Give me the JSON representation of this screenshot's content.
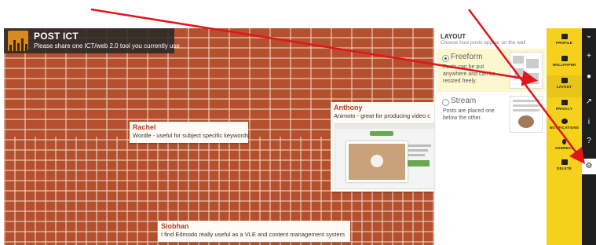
{
  "wall": {
    "title": "POST ICT",
    "subtitle": "Please share one ICT/web 2.0 tool you currently use"
  },
  "posts": [
    {
      "author": "Rachel",
      "body": "Wordle - useful for subject specific keywords"
    },
    {
      "author": "Anthony",
      "body": "Animoto - great for producing video c"
    },
    {
      "author": "Siobhan",
      "body": "I find Edmodo really useful as a VLE and content management system"
    }
  ],
  "layout_panel": {
    "title": "LAYOUT",
    "subtitle": "Choose how posts appear on the wall",
    "options": [
      {
        "name": "Freeform",
        "desc": "Posts can be put anywhere and can be resized freely.",
        "selected": true
      },
      {
        "name": "Stream",
        "desc": "Posts are placed one below the other.",
        "selected": false
      }
    ]
  },
  "sidebar": {
    "items": [
      {
        "label": "PROFILE",
        "icon": "profile-icon"
      },
      {
        "label": "WALLPAPER",
        "icon": "wallpaper-icon"
      },
      {
        "label": "LAYOUT",
        "icon": "layout-icon"
      },
      {
        "label": "PRIVACY",
        "icon": "lock-icon"
      },
      {
        "label": "NOTIFICATIONS",
        "icon": "eye-icon"
      },
      {
        "label": "ADDRESS",
        "icon": "key-icon"
      },
      {
        "label": "DELETE",
        "icon": "trash-icon"
      }
    ]
  },
  "rail": {
    "icons": [
      "chevron-down-icon",
      "plus-icon",
      "user-icon",
      "share-icon",
      "info-icon",
      "help-icon",
      "gear-icon"
    ],
    "glyphs": [
      "⌄",
      "+",
      "●",
      "↗",
      "i",
      "?",
      "⚙"
    ]
  },
  "colors": {
    "brick": "#b5502e",
    "sidebar_yellow": "#f6d11b",
    "author_red": "#b83a2a",
    "arrow_red": "#e0161b",
    "rail_dark": "#1e1e1e"
  }
}
